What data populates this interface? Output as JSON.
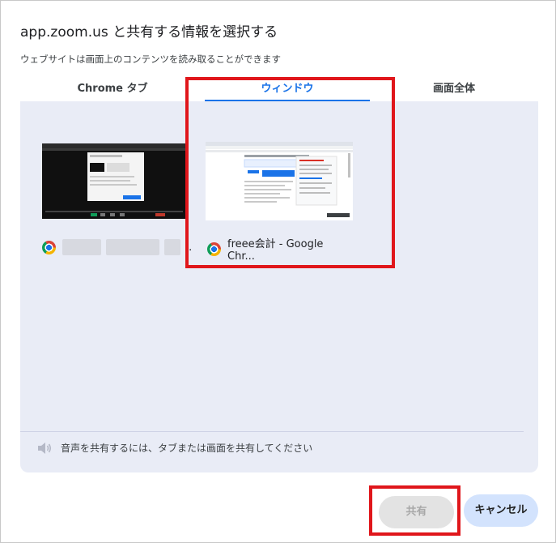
{
  "dialog": {
    "title": "app.zoom.us と共有する情報を選択する",
    "subtitle": "ウェブサイトは画面上のコンテンツを読み取ることができます"
  },
  "tabs": [
    {
      "label": "Chrome タブ",
      "active": false
    },
    {
      "label": "ウィンドウ",
      "active": true
    },
    {
      "label": "画面全体",
      "active": false
    }
  ],
  "windows": [
    {
      "title_visible": "..",
      "icon": "chrome-icon",
      "title_blurred": true,
      "selected": false
    },
    {
      "title_visible": "freee会計 - Google Chr...",
      "icon": "chrome-icon",
      "selected": true
    }
  ],
  "audio_note": "音声を共有するには、タブまたは画面を共有してください",
  "buttons": {
    "share": "共有",
    "cancel": "キャンセル"
  },
  "colors": {
    "accent": "#1a73e8",
    "panel_bg": "#e9ecf6",
    "highlight": "#e0161b"
  }
}
